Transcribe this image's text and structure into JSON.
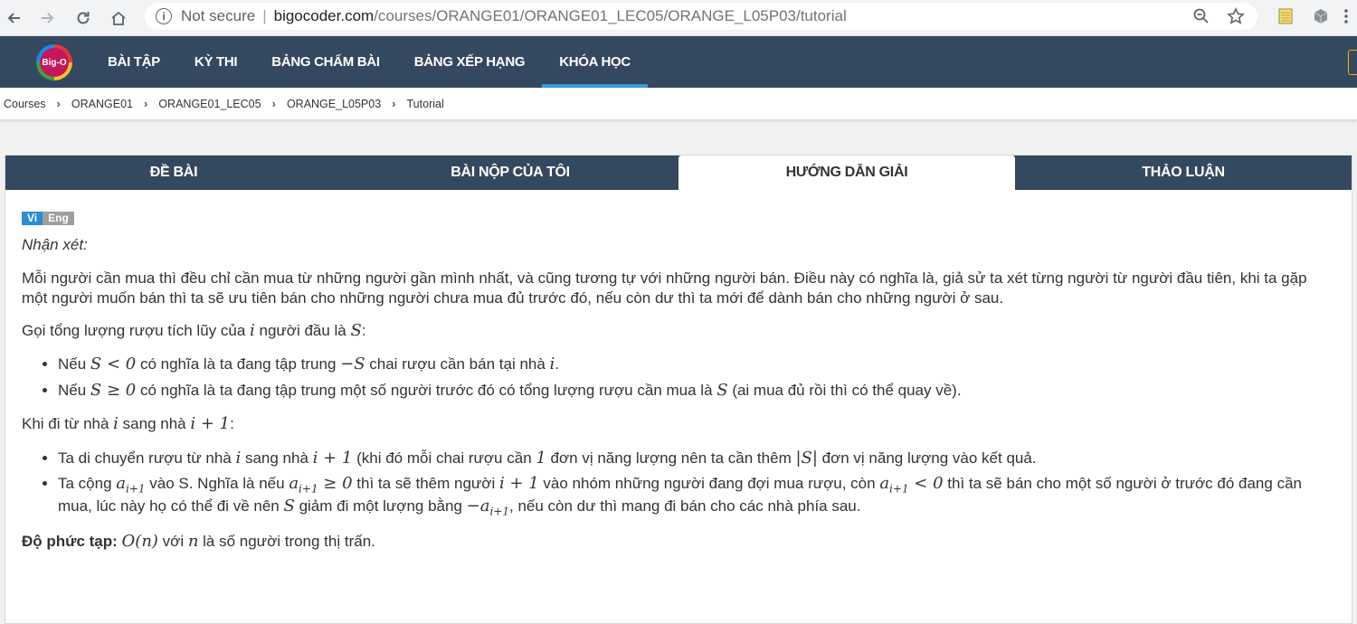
{
  "browser": {
    "secure_label": "Not secure",
    "url_domain": "bigocoder.com",
    "url_path": "/courses/ORANGE01/ORANGE01_LEC05/ORANGE_L05P03/tutorial"
  },
  "site": {
    "logo_text": "Big-O",
    "nav": [
      "BÀI TẬP",
      "KỲ THI",
      "BẢNG CHẤM BÀI",
      "BẢNG XẾP HẠNG",
      "KHÓA HỌC"
    ],
    "active_nav": "KHÓA HỌC"
  },
  "breadcrumb": [
    "Courses",
    "ORANGE01",
    "ORANGE01_LEC05",
    "ORANGE_L05P03",
    "Tutorial"
  ],
  "tabs": [
    "ĐỀ BÀI",
    "BÀI NỘP CỦA TÔI",
    "HƯỚNG DẪN GIẢI",
    "THẢO LUẬN"
  ],
  "active_tab": "HƯỚNG DẪN GIẢI",
  "lang": {
    "vi": "Vi",
    "en": "Eng"
  },
  "tutorial": {
    "heading": "Nhận xét:",
    "p1": "Mỗi người cần mua thì đều chỉ cần mua từ những người gần mình nhất, và cũng tương tự với những người bán. Điều này có nghĩa là, giả sử ta xét từng người từ người đầu tiên, khi ta gặp một người muốn bán thì ta sẽ ưu tiên bán cho những người chưa mua đủ trước đó, nếu còn dư thì ta mới để dành bán cho những người ở sau.",
    "p2": {
      "a": "Gọi tổng lượng rượu tích lũy của ",
      "m1": "i",
      "b": " người đầu là ",
      "m2": "S",
      "c": ":"
    },
    "list1": [
      {
        "a": "Nếu ",
        "m1": "S < 0",
        "b": " có nghĩa là ta đang tập trung ",
        "m2": "−S",
        "c": " chai rượu cần bán tại nhà ",
        "m3": "i",
        "d": "."
      },
      {
        "a": "Nếu ",
        "m1": "S ≥ 0",
        "b": " có nghĩa là ta đang tập trung một số người trước đó có tổng lượng rượu cần mua là ",
        "m2": "S",
        "c": " (ai mua đủ rồi thì có thể quay về)."
      }
    ],
    "p3": {
      "a": "Khi đi từ nhà ",
      "m1": "i",
      "b": " sang nhà ",
      "m2": "i + 1",
      "c": ":"
    },
    "list2": [
      {
        "a": "Ta di chuyển rượu từ nhà ",
        "m1": "i",
        "b": " sang nhà ",
        "m2": "i + 1",
        "c": " (khi đó mỗi chai rượu cần ",
        "m3": "1",
        "d": " đơn vị năng lượng nên ta cần thêm ",
        "m4": "|S|",
        "e": " đơn vị năng lượng vào kết quả."
      },
      {
        "a": "Ta cộng ",
        "m1": "a",
        "s1": "i+1",
        "b": " vào S. Nghĩa là nếu ",
        "m2": "a",
        "s2": "i+1",
        "m2b": " ≥ 0",
        "c": " thì ta sẽ thêm người ",
        "m3": "i + 1",
        "d": " vào nhóm những người đang đợi mua rượu, còn ",
        "m4": "a",
        "s4": "i+1",
        "m4b": " < 0",
        "e": " thì ta sẽ bán cho một số người ở trước đó đang cần mua, lúc này họ có thể đi về nên ",
        "m5": "S",
        "f": " giảm đi một lượng bằng ",
        "m6": "−a",
        "s6": "i+1",
        "g": ", nếu còn dư thì mang đi bán cho các nhà phía sau."
      }
    ],
    "complexity": {
      "label": "Độ phức tạp:",
      "m1": "O(n)",
      "a": " với ",
      "m2": "n",
      "b": " là số người trong thị trấn."
    }
  }
}
